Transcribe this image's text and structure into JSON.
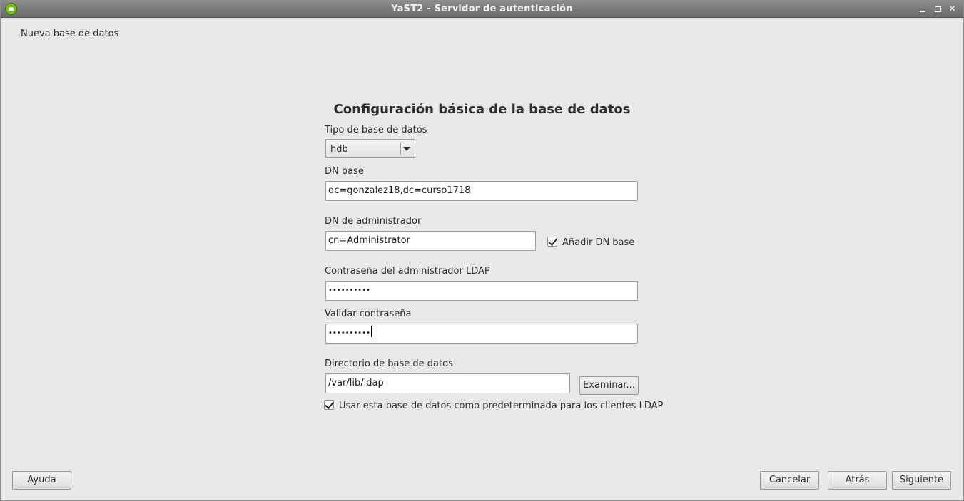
{
  "window": {
    "title": "YaST2 - Servidor de autenticación"
  },
  "breadcrumb": "Nueva base de datos",
  "heading": "Configuración básica de la base de datos",
  "form": {
    "db_type": {
      "label": "Tipo de base de datos",
      "value": "hdb"
    },
    "base_dn": {
      "label": "DN base",
      "value": "dc=gonzalez18,dc=curso1718"
    },
    "admin_dn": {
      "label": "DN de administrador",
      "value": "cn=Administrator",
      "append_base_label": "Añadir DN base",
      "append_base_checked": true
    },
    "admin_password": {
      "label": "Contraseña del administrador LDAP",
      "value": "••••••••••"
    },
    "validate_password": {
      "label": "Validar contraseña",
      "value": "••••••••••"
    },
    "db_directory": {
      "label": "Directorio de base de datos",
      "value": "/var/lib/ldap",
      "browse_label": "Examinar..."
    },
    "default_db": {
      "label": "Usar esta base de datos como predeterminada para los clientes LDAP",
      "checked": true
    }
  },
  "footer": {
    "help_label": "Ayuda",
    "cancel_label": "Cancelar",
    "back_label": "Atrás",
    "next_label": "Siguiente"
  },
  "icons": {
    "app": "opensuse-chameleon-icon",
    "minimize": "minimize-icon",
    "maximize": "maximize-icon",
    "close": "close-icon"
  }
}
